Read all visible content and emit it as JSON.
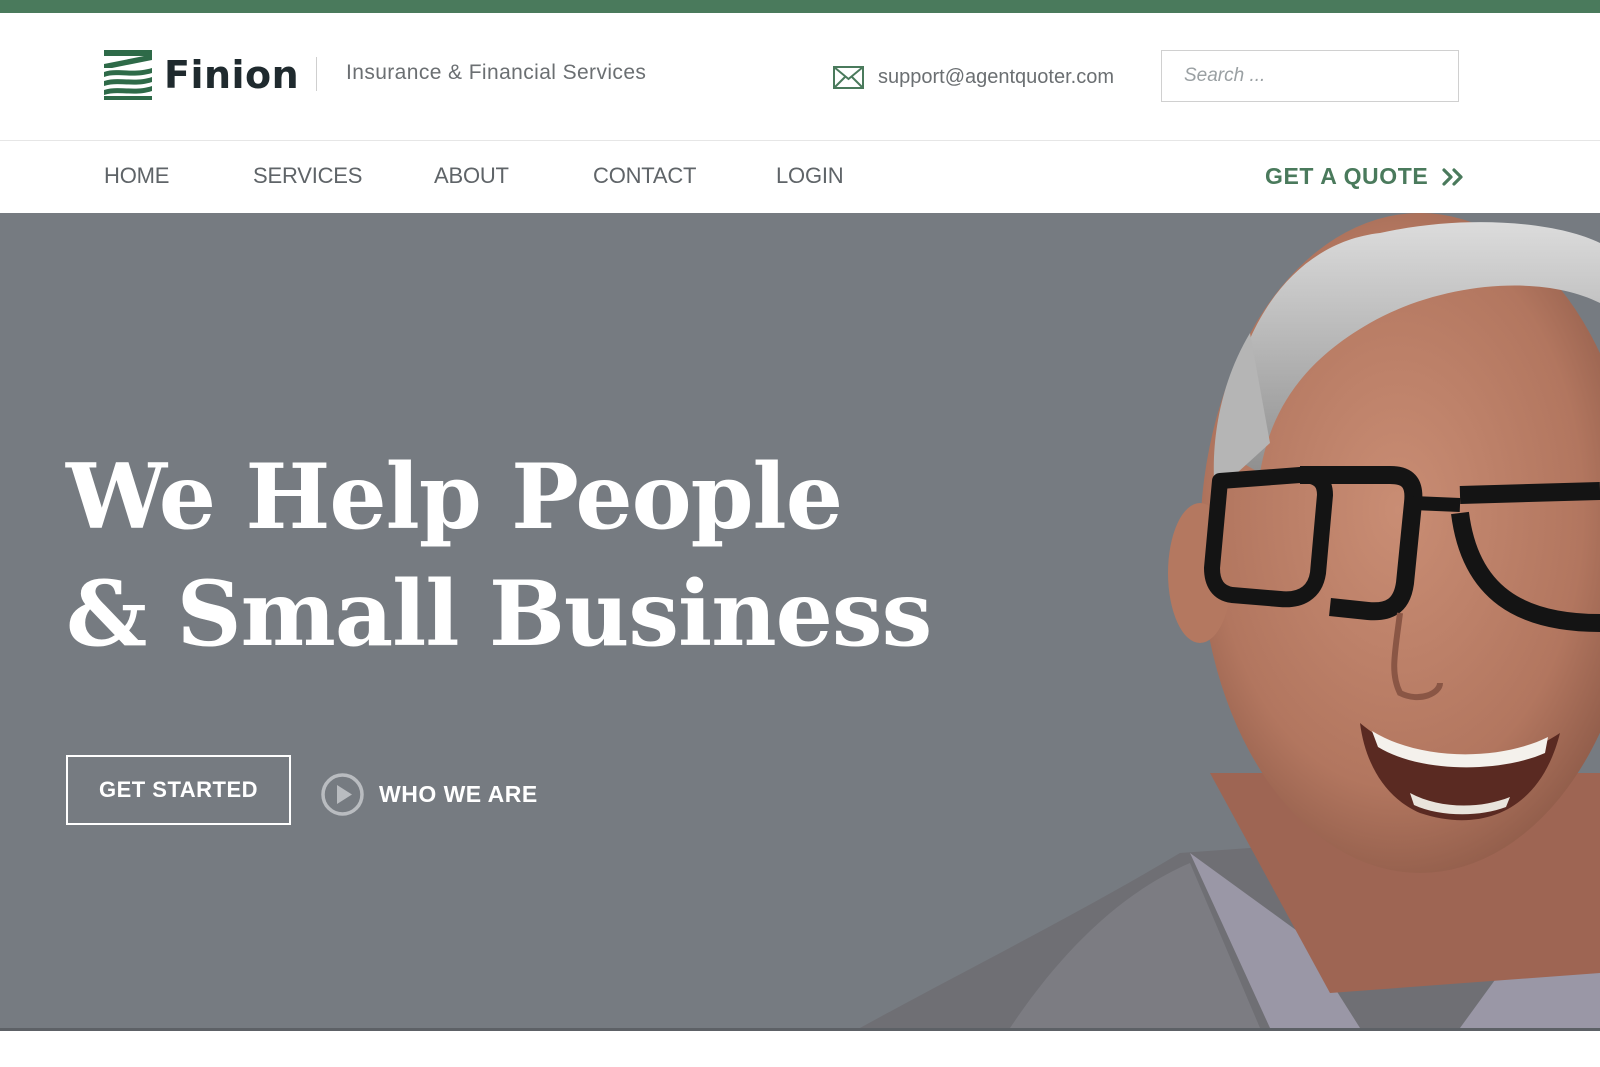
{
  "brand": {
    "name": "Finion",
    "tagline": "Insurance & Financial Services",
    "accent_color": "#4a7a5c"
  },
  "header": {
    "email": "support@agentquoter.com",
    "email_icon": "envelope-icon",
    "search": {
      "placeholder": "Search ...",
      "value": ""
    }
  },
  "nav": {
    "items": [
      {
        "label": "HOME"
      },
      {
        "label": "SERVICES"
      },
      {
        "label": "ABOUT"
      },
      {
        "label": "CONTACT"
      },
      {
        "label": "LOGIN"
      }
    ],
    "cta": {
      "label": "GET A QUOTE",
      "icon": "double-chevron-right-icon"
    }
  },
  "hero": {
    "title_line1": "We Help People",
    "title_line2": "& Small Business",
    "primary_button": "GET STARTED",
    "secondary_link": "WHO WE ARE",
    "secondary_icon": "play-circle-icon",
    "background_color": "#767b81",
    "image": "smiling man with glasses"
  }
}
